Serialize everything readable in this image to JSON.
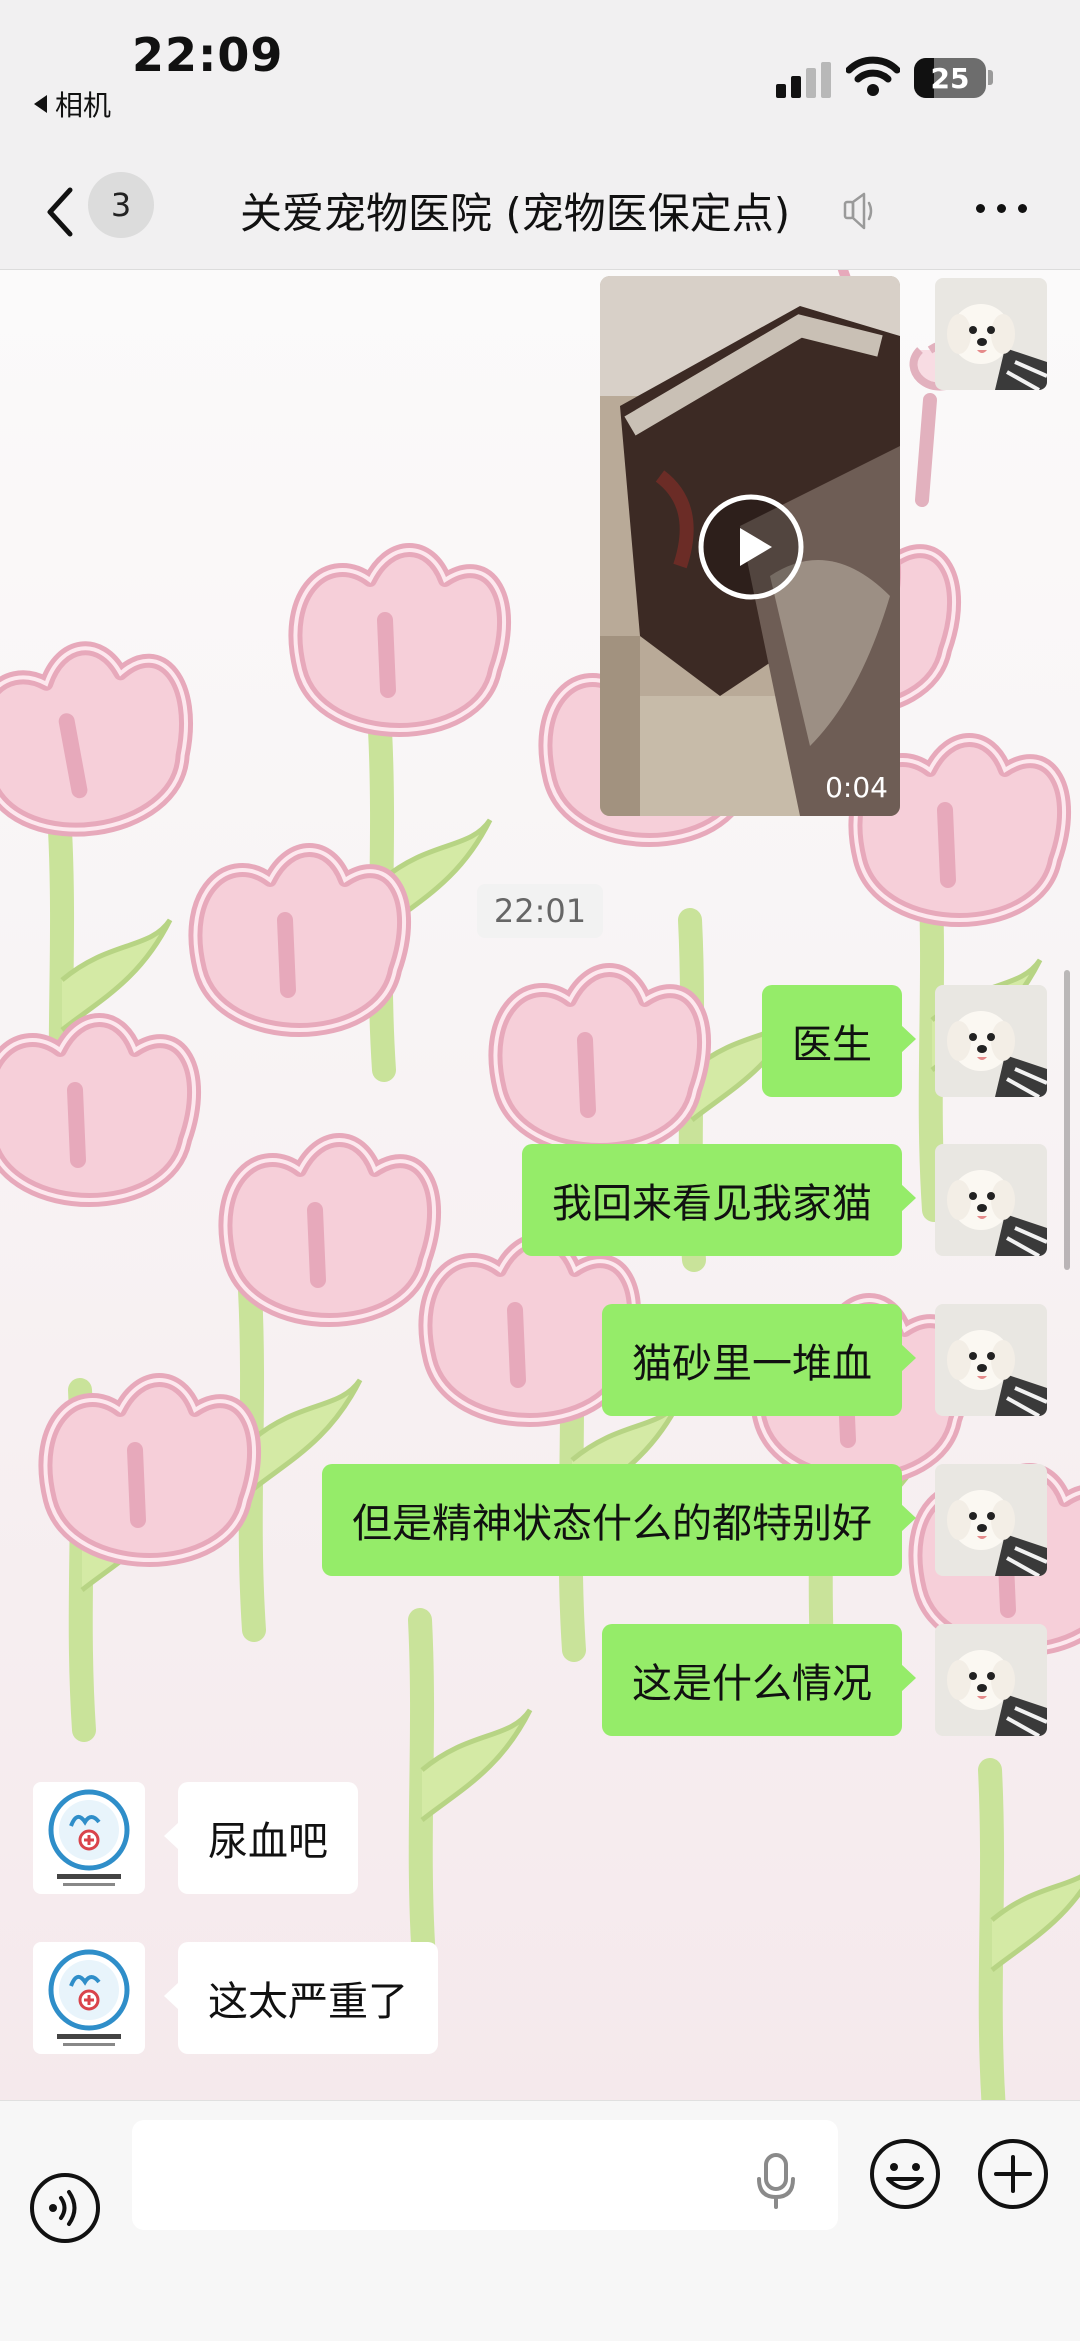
{
  "status_bar": {
    "time": "22:09",
    "back_app_label": "相机",
    "battery_level": "25",
    "signal_bars_active": 2,
    "signal_bars_total": 4,
    "icons": [
      "signal-icon",
      "wifi-icon",
      "battery-icon"
    ]
  },
  "nav": {
    "back_icon": "chevron-left-icon",
    "unread_count": "3",
    "title": "关爱宠物医院 (宠物医保定点)",
    "mute_icon": "speaker-muted-icon",
    "more_icon": "more-icon"
  },
  "chat": {
    "video_message": {
      "duration": "0:04",
      "play_icon": "play-icon"
    },
    "time_divider": "22:01",
    "messages_me": [
      {
        "text": "医生"
      },
      {
        "text": "我回来看见我家猫"
      },
      {
        "text": "猫砂里一堆血"
      },
      {
        "text": "但是精神状态什么的都特别好"
      },
      {
        "text": "这是什么情况"
      }
    ],
    "messages_them": [
      {
        "text": "尿血吧"
      },
      {
        "text": "这太严重了"
      }
    ]
  },
  "input_bar": {
    "placeholder": "",
    "voice_icon": "voice-toggle-icon",
    "mic_icon": "microphone-icon",
    "emoji_icon": "emoji-icon",
    "plus_icon": "plus-icon"
  },
  "colors": {
    "bubble_me": "#95ec69",
    "bubble_them": "#ffffff",
    "bar_background": "#f1f0f1"
  }
}
